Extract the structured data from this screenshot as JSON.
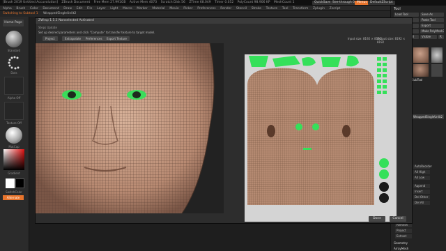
{
  "titlebar": {
    "items": [
      "[Brush 2019 Untitled Accuvolution]",
      "ZBrush Document",
      "Free Mem 27.991GB",
      "Active Mem 4073",
      "Scratch Disk 56",
      "ZTime 68.049",
      "Timer 0.052",
      "PolyCount 98.906 KP",
      "MeshCount 1"
    ],
    "quicksave": "QuickSave",
    "see_through": "See-through 0",
    "menus": "Menus",
    "script": "DefaultZScript"
  },
  "menubar": {
    "items": [
      "Alpha",
      "Brush",
      "Color",
      "Document",
      "Draw",
      "Edit",
      "File",
      "Layer",
      "Light",
      "Macro",
      "Marker",
      "Material",
      "Movie",
      "Picker",
      "Preferences",
      "Render",
      "Stencil",
      "Stroke",
      "Texture",
      "Tool",
      "Transform",
      "Zplugin",
      "Zscript"
    ]
  },
  "subbar": {
    "switching": "Switching to Subtool 1",
    "doc": "WrappedSingleUnlit2"
  },
  "left": {
    "home": "Home Page",
    "standard": "Standard",
    "dots": "Dots",
    "alpha_off": "Alpha Off",
    "texture_off": "Texture Off",
    "matcap": "MatCap",
    "gradient": "Gradient",
    "switch_color": "SwitchColor",
    "alternate": "Alternate"
  },
  "right": {
    "tool": "Tool",
    "load_tool": "Load Tool",
    "save_as": "Save As",
    "copy_tool": "Copy Tool",
    "paste_tool": "Paste Tool",
    "import": "Import",
    "export": "Export",
    "clone": "Clone",
    "make_polymesh": "Make PolyMesh3D",
    "goz": "GoZ",
    "all": "All",
    "visible": "Visible",
    "r": "R",
    "subtool": "SubTool",
    "doc_label": "WrappedSingleUnlit2",
    "auto_reorder": "AutoReorder",
    "all_high": "All High",
    "all_low": "All Low",
    "append": "Append",
    "insert": "Insert",
    "del_other": "Del Other",
    "del_all": "Del All",
    "remesh": "Remesh",
    "project": "Project",
    "extract": "Extract",
    "geometry": "Geometry",
    "arraymesh": "ArrayMesh"
  },
  "dialog": {
    "title": "ZWrap 1.1.1  Nonselected Activated",
    "steps": "Steps   Update",
    "instructions": "Set up desired parameters and click \"Compute\" to transfer texture to target model.",
    "tabs": [
      "Project",
      "Extrapolate",
      "Preferences",
      "Export Texture"
    ],
    "input_size": "Input size: 8192 × 8192",
    "output_size": "Output size: 8192 × 8192",
    "done": "Done",
    "cancel": "Cancel"
  },
  "colors": {
    "accent": "#e8742c",
    "wire": "#5a3f33",
    "skin": "#c49a82",
    "uv_bg": "#b58a72",
    "green": "#35e05a"
  }
}
